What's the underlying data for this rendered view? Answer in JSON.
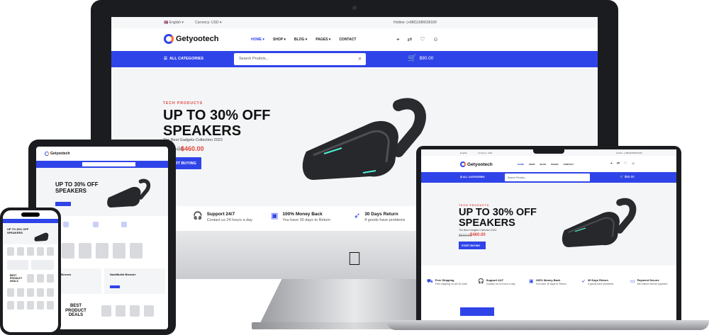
{
  "store": {
    "name": "Getyootech",
    "language": "English",
    "currency": "Currency: USD",
    "hotline": "Hotline: (+880)1686636189"
  },
  "menu": [
    "HOME",
    "SHOP",
    "BLOG",
    "PAGES",
    "CONTACT"
  ],
  "bar": {
    "all_categories": "ALL CATEGORIES",
    "search_placeholder": "Search Prudcts...",
    "cart_total": "$90.00"
  },
  "hero": {
    "tag": "TECH PRODUCTS",
    "headline_line1": "UP TO 30% OFF",
    "headline_line2": "SPEAKERS",
    "subtitle": "The Best Gadgets Collection 2023",
    "old_price": "$610.00",
    "new_price": "$460.00",
    "cta": "START BUYING"
  },
  "features": [
    {
      "title": "Free Shipping",
      "text": "Free shipping on all US order",
      "icon": "truck-icon"
    },
    {
      "title": "Support 24/7",
      "text": "Contact us 24 hours a day",
      "icon": "headset-icon"
    },
    {
      "title": "100% Money Back",
      "text": "You have 30 days to Return",
      "icon": "wallet-icon"
    },
    {
      "title": "30 Days Return",
      "text": "If goods have problems",
      "icon": "rocket-icon"
    },
    {
      "title": "Payment Secure",
      "text": "We ensure secure payment",
      "icon": "card-icon"
    }
  ],
  "tablet": {
    "promo1": "Protective Sleeves",
    "promo2": "NutriBullet Blender",
    "deals": "BEST PRODUCT DEALS"
  },
  "phone": {
    "deals": "BEST PRODUCT DEALS"
  },
  "colors": {
    "accent": "#2f44e8",
    "sale": "#e4453a",
    "device_frame": "#1b1c1f"
  }
}
